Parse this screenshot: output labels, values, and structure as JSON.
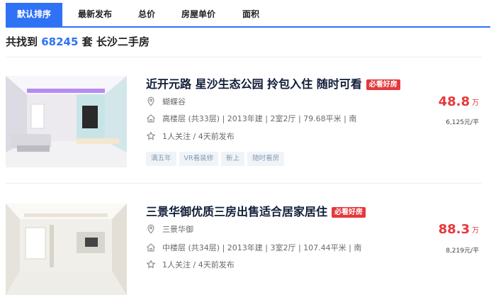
{
  "tabs": [
    "默认排序",
    "最新发布",
    "总价",
    "房屋单价",
    "面积"
  ],
  "summary": {
    "prefix": "共找到",
    "count": "68245",
    "suffix": "套 长沙二手房"
  },
  "listings": [
    {
      "title": "近开元路 星沙生态公园 拎包入住 随时可看",
      "badge": "必看好房",
      "community": "蝴蝶谷",
      "details": "高楼层 (共33层) | 2013年建 | 2室2厅 | 79.68平米 | 南",
      "followers": "1人关注 / 4天前发布",
      "tags": [
        "满五年",
        "VR看装修",
        "新上",
        "随时看房"
      ],
      "price": "48.8",
      "price_unit": "万",
      "unit_price": "6,125元/平"
    },
    {
      "title": "三景华御优质三房出售适合居家居住",
      "badge": "必看好房",
      "community": "三景华御",
      "details": "中楼层 (共34层) | 2013年建 | 3室2厅 | 107.44平米 | 南",
      "followers": "1人关注 / 4天前发布",
      "price": "88.3",
      "price_unit": "万",
      "unit_price": "8,219元/平"
    }
  ],
  "colors": {
    "accent": "#3072f6",
    "price": "#e4393c",
    "tag_bg": "#f0f4f9"
  }
}
